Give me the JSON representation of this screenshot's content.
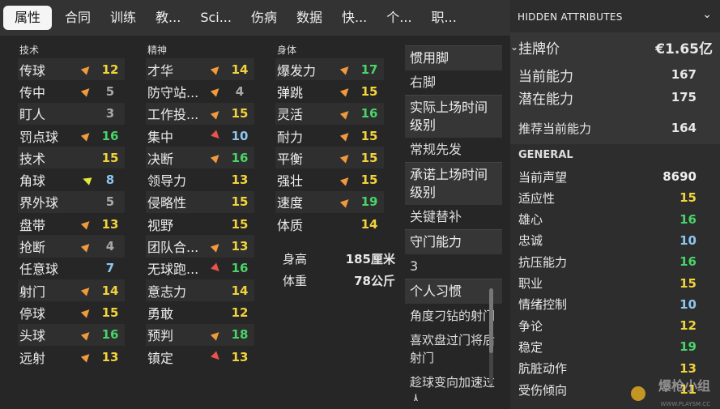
{
  "tabs": [
    "属性",
    "合同",
    "训练",
    "教...",
    "Sci...",
    "伤病",
    "数据",
    "快...",
    "个...",
    "职..."
  ],
  "technical": {
    "heading": "技术",
    "rows": [
      {
        "label": "传球",
        "arrow": "up",
        "value": "12",
        "color": "yellow"
      },
      {
        "label": "传中",
        "arrow": "up",
        "value": "5",
        "color": "gray"
      },
      {
        "label": "盯人",
        "arrow": "",
        "value": "3",
        "color": "gray"
      },
      {
        "label": "罚点球",
        "arrow": "up",
        "value": "16",
        "color": "green"
      },
      {
        "label": "技术",
        "arrow": "",
        "value": "15",
        "color": "yellow"
      },
      {
        "label": "角球",
        "arrow": "side",
        "value": "8",
        "color": "blue"
      },
      {
        "label": "界外球",
        "arrow": "",
        "value": "5",
        "color": "gray"
      },
      {
        "label": "盘带",
        "arrow": "up",
        "value": "13",
        "color": "yellow"
      },
      {
        "label": "抢断",
        "arrow": "up",
        "value": "4",
        "color": "gray"
      },
      {
        "label": "任意球",
        "arrow": "",
        "value": "7",
        "color": "blue"
      },
      {
        "label": "射门",
        "arrow": "up",
        "value": "14",
        "color": "yellow"
      },
      {
        "label": "停球",
        "arrow": "up",
        "value": "15",
        "color": "yellow"
      },
      {
        "label": "头球",
        "arrow": "up",
        "value": "16",
        "color": "green"
      },
      {
        "label": "远射",
        "arrow": "up",
        "value": "13",
        "color": "yellow"
      }
    ]
  },
  "mental": {
    "heading": "精神",
    "rows": [
      {
        "label": "才华",
        "arrow": "up",
        "value": "14",
        "color": "yellow"
      },
      {
        "label": "防守站...",
        "arrow": "up",
        "value": "4",
        "color": "gray"
      },
      {
        "label": "工作投...",
        "arrow": "up",
        "value": "15",
        "color": "yellow"
      },
      {
        "label": "集中",
        "arrow": "down",
        "value": "10",
        "color": "blue"
      },
      {
        "label": "决断",
        "arrow": "up",
        "value": "16",
        "color": "green"
      },
      {
        "label": "领导力",
        "arrow": "",
        "value": "13",
        "color": "yellow"
      },
      {
        "label": "侵略性",
        "arrow": "",
        "value": "15",
        "color": "yellow"
      },
      {
        "label": "视野",
        "arrow": "",
        "value": "15",
        "color": "yellow"
      },
      {
        "label": "团队合...",
        "arrow": "up",
        "value": "13",
        "color": "yellow"
      },
      {
        "label": "无球跑...",
        "arrow": "down",
        "value": "16",
        "color": "green"
      },
      {
        "label": "意志力",
        "arrow": "",
        "value": "14",
        "color": "yellow"
      },
      {
        "label": "勇敢",
        "arrow": "",
        "value": "12",
        "color": "yellow"
      },
      {
        "label": "预判",
        "arrow": "up",
        "value": "18",
        "color": "green"
      },
      {
        "label": "镇定",
        "arrow": "down",
        "value": "13",
        "color": "yellow"
      }
    ]
  },
  "physical": {
    "heading": "身体",
    "rows": [
      {
        "label": "爆发力",
        "arrow": "up",
        "value": "17",
        "color": "green"
      },
      {
        "label": "弹跳",
        "arrow": "up",
        "value": "15",
        "color": "yellow"
      },
      {
        "label": "灵活",
        "arrow": "up",
        "value": "16",
        "color": "green"
      },
      {
        "label": "耐力",
        "arrow": "up",
        "value": "15",
        "color": "yellow"
      },
      {
        "label": "平衡",
        "arrow": "up",
        "value": "15",
        "color": "yellow"
      },
      {
        "label": "强壮",
        "arrow": "up",
        "value": "15",
        "color": "yellow"
      },
      {
        "label": "速度",
        "arrow": "up",
        "value": "19",
        "color": "green"
      },
      {
        "label": "体质",
        "arrow": "",
        "value": "14",
        "color": "yellow"
      }
    ]
  },
  "body": {
    "height_label": "身高",
    "height_value": "185厘米",
    "weight_label": "体重",
    "weight_value": "78公斤"
  },
  "side_info": {
    "foot_label": "惯用脚",
    "foot_value": "右脚",
    "actual_level_label": "实际上场时间级别",
    "actual_level_value": "常规先发",
    "promised_level_label": "承诺上场时间级别",
    "promised_level_value": "关键替补",
    "gk_label": "守门能力",
    "gk_value": "3",
    "habits_label": "个人习惯",
    "habits": [
      "角度刁钻的射门",
      "喜欢盘过门将后射门",
      "趁球变向加速过人"
    ]
  },
  "hidden": {
    "title": "HIDDEN ATTRIBUTES",
    "price_label": "挂牌价",
    "price_value": "€1.65亿",
    "ca_label": "当前能力",
    "ca_value": "167",
    "pa_label": "潜在能力",
    "pa_value": "175",
    "rec_label": "推荐当前能力",
    "rec_value": "164",
    "general_title": "GENERAL",
    "general": [
      {
        "label": "当前声望",
        "value": "8690",
        "color": "white"
      },
      {
        "label": "适应性",
        "value": "15",
        "color": "yellow"
      },
      {
        "label": "雄心",
        "value": "16",
        "color": "green"
      },
      {
        "label": "忠诚",
        "value": "10",
        "color": "blue"
      },
      {
        "label": "抗压能力",
        "value": "16",
        "color": "green"
      },
      {
        "label": "职业",
        "value": "15",
        "color": "yellow"
      },
      {
        "label": "情绪控制",
        "value": "10",
        "color": "blue"
      },
      {
        "label": "争论",
        "value": "12",
        "color": "yellow"
      },
      {
        "label": "稳定",
        "value": "19",
        "color": "green"
      },
      {
        "label": "肮脏动作",
        "value": "13",
        "color": "yellow"
      },
      {
        "label": "受伤倾向",
        "value": "11",
        "color": "yellow"
      }
    ]
  },
  "watermark": {
    "text": "爆枪小组",
    "sub": "WWW.PLAYSM.CC"
  },
  "colors": {
    "yellow": "#f2d33b",
    "green": "#49d46a",
    "blue": "#8ec6f0",
    "gray": "#a8a8a8",
    "arrow_up": "#f09a3c",
    "arrow_down": "#e8534a",
    "arrow_side": "#e4e83a"
  }
}
